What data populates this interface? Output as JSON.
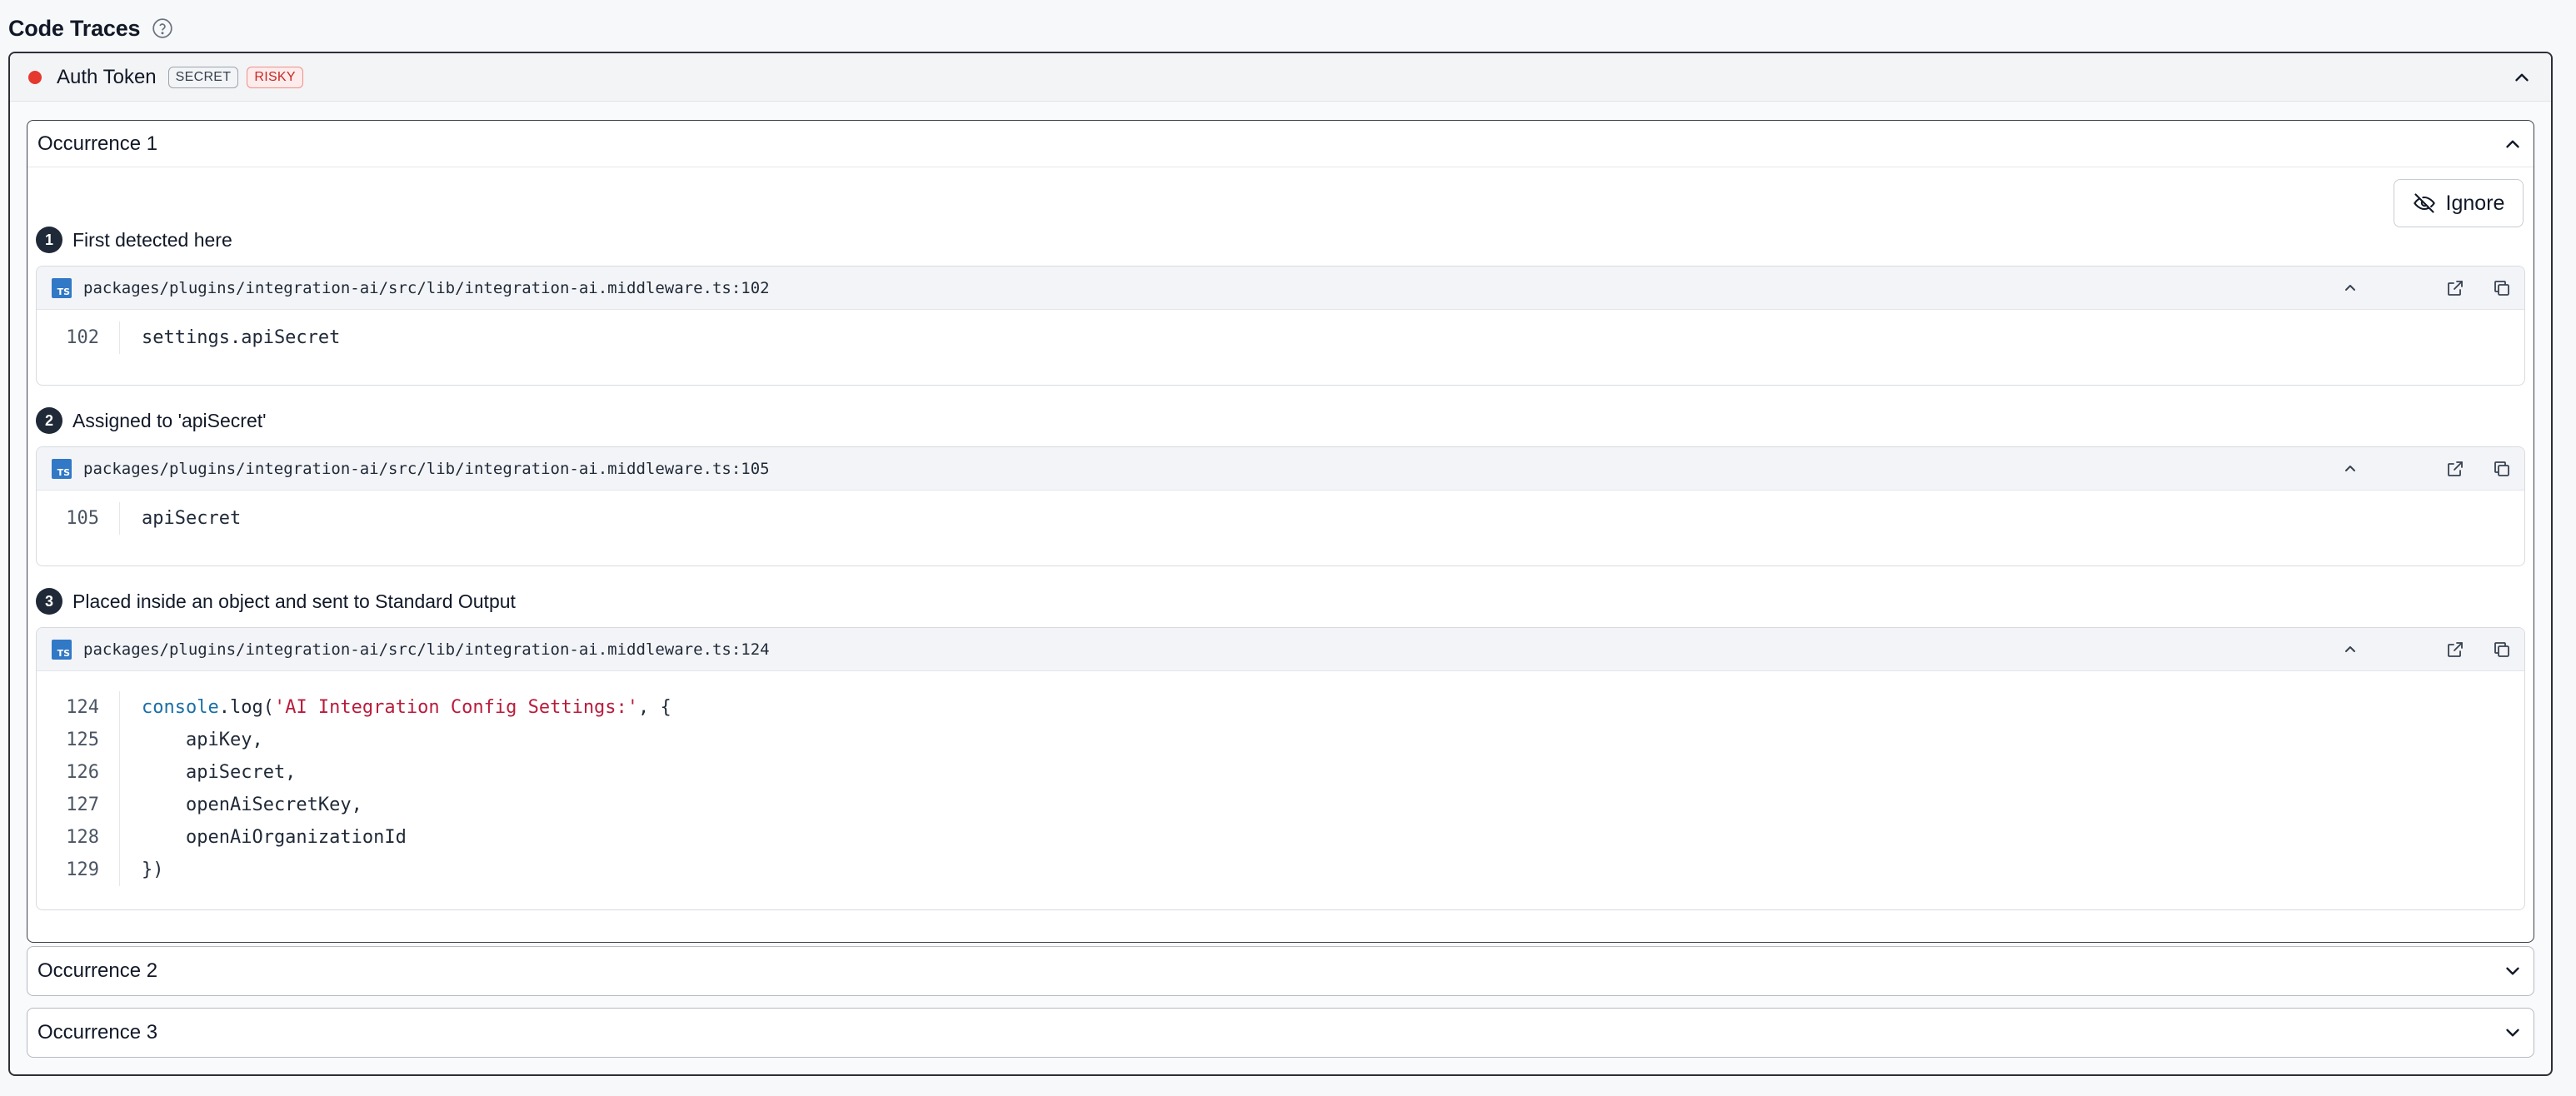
{
  "page": {
    "title": "Code Traces",
    "help_icon": "question-circle-icon"
  },
  "finding": {
    "title": "Auth Token",
    "status_color": "#e5382f",
    "badges": [
      {
        "label": "SECRET"
      },
      {
        "label": "RISKY"
      }
    ]
  },
  "occurrences": [
    {
      "title": "Occurrence 1",
      "expanded": true,
      "ignore_label": "Ignore",
      "steps": [
        {
          "num": "1",
          "label": "First detected here",
          "file": "packages/plugins/integration-ai/src/lib/integration-ai.middleware.ts:102",
          "lines": [
            {
              "n": "102",
              "code": "settings.apiSecret"
            }
          ]
        },
        {
          "num": "2",
          "label": "Assigned to 'apiSecret'",
          "file": "packages/plugins/integration-ai/src/lib/integration-ai.middleware.ts:105",
          "lines": [
            {
              "n": "105",
              "code": "apiSecret"
            }
          ]
        },
        {
          "num": "3",
          "label": "Placed inside an object and sent to Standard Output",
          "file": "packages/plugins/integration-ai/src/lib/integration-ai.middleware.ts:124",
          "lines": [
            {
              "n": "124",
              "code_fn": "console",
              "code_mid": ".log(",
              "code_str": "'AI Integration Config Settings:'",
              "code_end": ", {"
            },
            {
              "n": "125",
              "code": "    apiKey,"
            },
            {
              "n": "126",
              "code": "    apiSecret,"
            },
            {
              "n": "127",
              "code": "    openAiSecretKey,"
            },
            {
              "n": "128",
              "code": "    openAiOrganizationId"
            },
            {
              "n": "129",
              "code": "})"
            }
          ]
        }
      ]
    },
    {
      "title": "Occurrence 2",
      "expanded": false
    },
    {
      "title": "Occurrence 3",
      "expanded": false
    }
  ],
  "colors": {
    "accent_dark": "#1f2937",
    "risky": "#c62828",
    "ts_blue": "#3178c6",
    "code_fn": "#1b6fa8",
    "code_str": "#b91c3c"
  }
}
